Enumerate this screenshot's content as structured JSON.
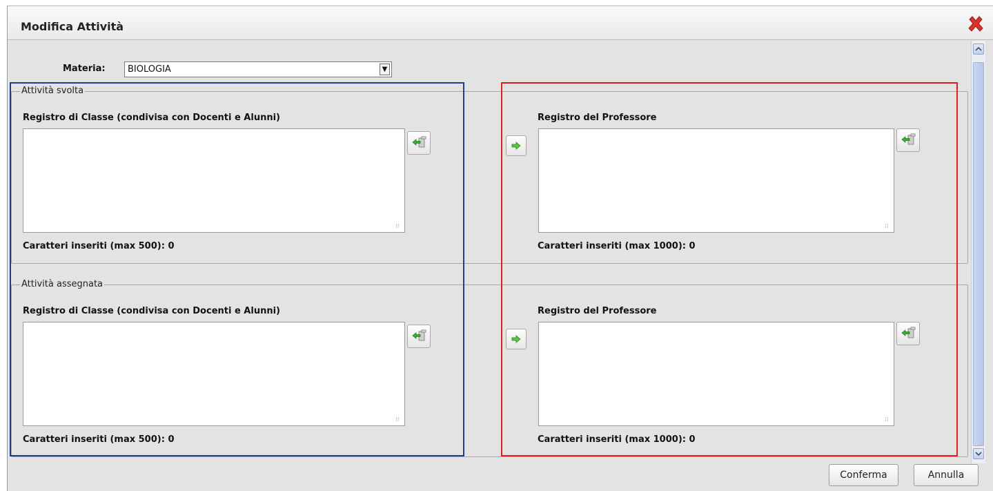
{
  "window": {
    "title": "Modifica Attività",
    "close_icon": "close-icon"
  },
  "materia": {
    "label": "Materia:",
    "value": "BIOLOGIA"
  },
  "sections": [
    {
      "legend": "Attività svolta",
      "classe": {
        "label": "Registro di Classe (condivisa con Docenti e Alunni)",
        "value": "",
        "counter": "Caratteri inseriti (max 500): 0"
      },
      "professore": {
        "label": "Registro del Professore",
        "value": "",
        "counter": "Caratteri inseriti (max 1000): 0"
      }
    },
    {
      "legend": "Attività assegnata",
      "classe": {
        "label": "Registro di Classe (condivisa con Docenti e Alunni)",
        "value": "",
        "counter": "Caratteri inseriti (max 500): 0"
      },
      "professore": {
        "label": "Registro del Professore",
        "value": "",
        "counter": "Caratteri inseriti (max 1000): 0"
      }
    }
  ],
  "buttons": {
    "confirm": "Conferma",
    "cancel": "Annulla"
  },
  "colors": {
    "highlight_left": "#1f3f88",
    "highlight_right": "#e31b23",
    "dialog_bg": "#e3e3e3"
  }
}
